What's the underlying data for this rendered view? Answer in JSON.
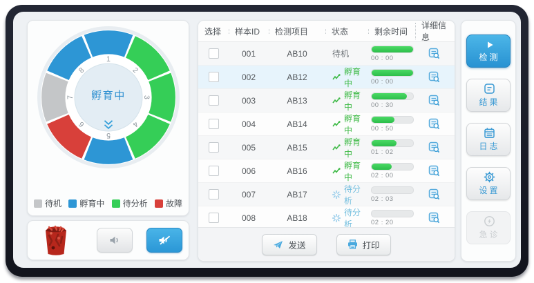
{
  "dial": {
    "center_label": "孵育中",
    "positions": [
      {
        "number": "1",
        "status": "孵育中",
        "color": "#2d96d5"
      },
      {
        "number": "2",
        "status": "待分析",
        "color": "#35ce57"
      },
      {
        "number": "3",
        "status": "待分析",
        "color": "#35ce57"
      },
      {
        "number": "4",
        "status": "待分析",
        "color": "#35ce57"
      },
      {
        "number": "5",
        "status": "孵育中",
        "color": "#2d96d5"
      },
      {
        "number": "6",
        "status": "故障",
        "color": "#d8403a"
      },
      {
        "number": "7",
        "status": "待机",
        "color": "#c4c6c8"
      },
      {
        "number": "8",
        "status": "孵育中",
        "color": "#2d96d5"
      }
    ]
  },
  "legend": [
    {
      "label": "待机",
      "color": "#c4c6c8"
    },
    {
      "label": "孵育中",
      "color": "#2d96d5"
    },
    {
      "label": "待分析",
      "color": "#35ce57"
    },
    {
      "label": "故障",
      "color": "#d8403a"
    }
  ],
  "sound_panel": {
    "waste_icon": "trash-bin-full",
    "buttons": [
      {
        "icon": "speaker-on-icon",
        "state": "normal"
      },
      {
        "icon": "speaker-muted-icon",
        "state": "active"
      }
    ]
  },
  "table": {
    "columns": [
      "选择",
      "样本ID",
      "检测项目",
      "状态",
      "剩余时间",
      "详细信息"
    ],
    "rows": [
      {
        "sample_id": "001",
        "item": "AB10",
        "status": "待机",
        "status_type": "standby",
        "progress_percent": 100,
        "remaining_time": "00 : 00",
        "selected": false,
        "highlighted": false
      },
      {
        "sample_id": "002",
        "item": "AB12",
        "status": "孵育中",
        "status_type": "incubating",
        "progress_percent": 100,
        "remaining_time": "00 : 00",
        "selected": false,
        "highlighted": true
      },
      {
        "sample_id": "003",
        "item": "AB13",
        "status": "孵育中",
        "status_type": "incubating",
        "progress_percent": 85,
        "remaining_time": "00 : 30",
        "selected": false,
        "highlighted": false
      },
      {
        "sample_id": "004",
        "item": "AB14",
        "status": "孵育中",
        "status_type": "incubating",
        "progress_percent": 55,
        "remaining_time": "00 : 50",
        "selected": false,
        "highlighted": false
      },
      {
        "sample_id": "005",
        "item": "AB15",
        "status": "孵育中",
        "status_type": "incubating",
        "progress_percent": 60,
        "remaining_time": "01 : 02",
        "selected": false,
        "highlighted": false
      },
      {
        "sample_id": "006",
        "item": "AB16",
        "status": "孵育中",
        "status_type": "incubating",
        "progress_percent": 48,
        "remaining_time": "02 : 00",
        "selected": false,
        "highlighted": false
      },
      {
        "sample_id": "007",
        "item": "AB17",
        "status": "待分析",
        "status_type": "pending",
        "progress_percent": 0,
        "remaining_time": "02 : 03",
        "selected": false,
        "highlighted": false
      },
      {
        "sample_id": "008",
        "item": "AB18",
        "status": "待分析",
        "status_type": "pending",
        "progress_percent": 0,
        "remaining_time": "02 : 20",
        "selected": false,
        "highlighted": false
      }
    ],
    "send_label": "发送",
    "print_label": "打印"
  },
  "sidebar": {
    "buttons": [
      {
        "label": "检测",
        "icon": "play-icon",
        "state": "active"
      },
      {
        "label": "结果",
        "icon": "results-icon",
        "state": "normal"
      },
      {
        "label": "日志",
        "icon": "calendar-icon",
        "state": "normal"
      },
      {
        "label": "设置",
        "icon": "gear-icon",
        "state": "normal"
      },
      {
        "label": "急诊",
        "icon": "bolt-icon",
        "state": "disabled"
      }
    ]
  },
  "colors": {
    "accent_blue": "#2d96d5",
    "status_green": "#3cb944",
    "pending_blue": "#72bede",
    "fault_red": "#d8403a",
    "standby_gray": "#c4c6c8",
    "progress_green": "#3ccf58",
    "highlight_row": "#e7f4fc"
  }
}
